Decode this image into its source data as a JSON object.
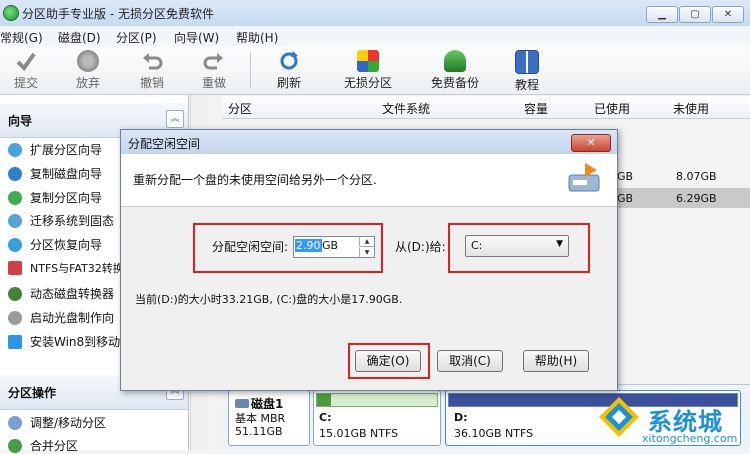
{
  "window": {
    "title": "分区助手专业版 - 无损分区免费软件"
  },
  "menu": [
    "常规(G)",
    "磁盘(D)",
    "分区(P)",
    "向导(W)",
    "帮助(H)"
  ],
  "toolbar": [
    {
      "label": "提交",
      "icon": "check-icon"
    },
    {
      "label": "放弃",
      "icon": "discard-icon"
    },
    {
      "label": "撤销",
      "icon": "undo-icon"
    },
    {
      "label": "重做",
      "icon": "redo-icon"
    },
    {
      "label": "刷新",
      "icon": "refresh-icon"
    },
    {
      "label": "无损分区",
      "icon": "partition-icon"
    },
    {
      "label": "免费备份",
      "icon": "backup-icon"
    },
    {
      "label": "教程",
      "icon": "book-icon"
    }
  ],
  "sidebar": {
    "wizard_header": "向导",
    "wizard_items": [
      "扩展分区向导",
      "复制磁盘向导",
      "复制分区向导",
      "迁移系统到固态",
      "分区恢复向导",
      "NTFS与FAT32转换",
      "动态磁盘转换器",
      "启动光盘制作向",
      "安装Win8到移动"
    ],
    "ops_header": "分区操作",
    "ops_items": [
      "调整/移动分区",
      "合并分区"
    ]
  },
  "table": {
    "columns": [
      "分区",
      "文件系统",
      "容量",
      "已使用",
      "未使用"
    ],
    "rows": [
      {
        "partial": "GB",
        "unused": "8.07GB"
      },
      {
        "partial": "GB",
        "unused": "6.29GB"
      }
    ]
  },
  "disk": {
    "name": "磁盘1",
    "type": "基本 MBR",
    "size": "51.11GB",
    "partitions": [
      {
        "letter": "C:",
        "info": "15.01GB NTFS"
      },
      {
        "letter": "D:",
        "info": "36.10GB NTFS"
      }
    ]
  },
  "dialog": {
    "title": "分配空闲空间",
    "close": "✕",
    "description": "重新分配一个盘的未使用空间给另外一个分区.",
    "alloc_label": "分配空闲空间:",
    "alloc_value": "2.90",
    "alloc_unit": "GB",
    "from_label": "从(D:)给:",
    "target_value": "C:",
    "info": "当前(D:)的大小时33.21GB, (C:)盘的大小是17.90GB.",
    "ok": "确定(O)",
    "cancel": "取消(C)",
    "help": "帮助(H)"
  },
  "watermark": {
    "text": "系统城",
    "url": "xitongcheng.com"
  },
  "colors": {
    "highlight_red": "#e02020",
    "accent_blue": "#1e90d6",
    "selection": "#3399ff"
  }
}
